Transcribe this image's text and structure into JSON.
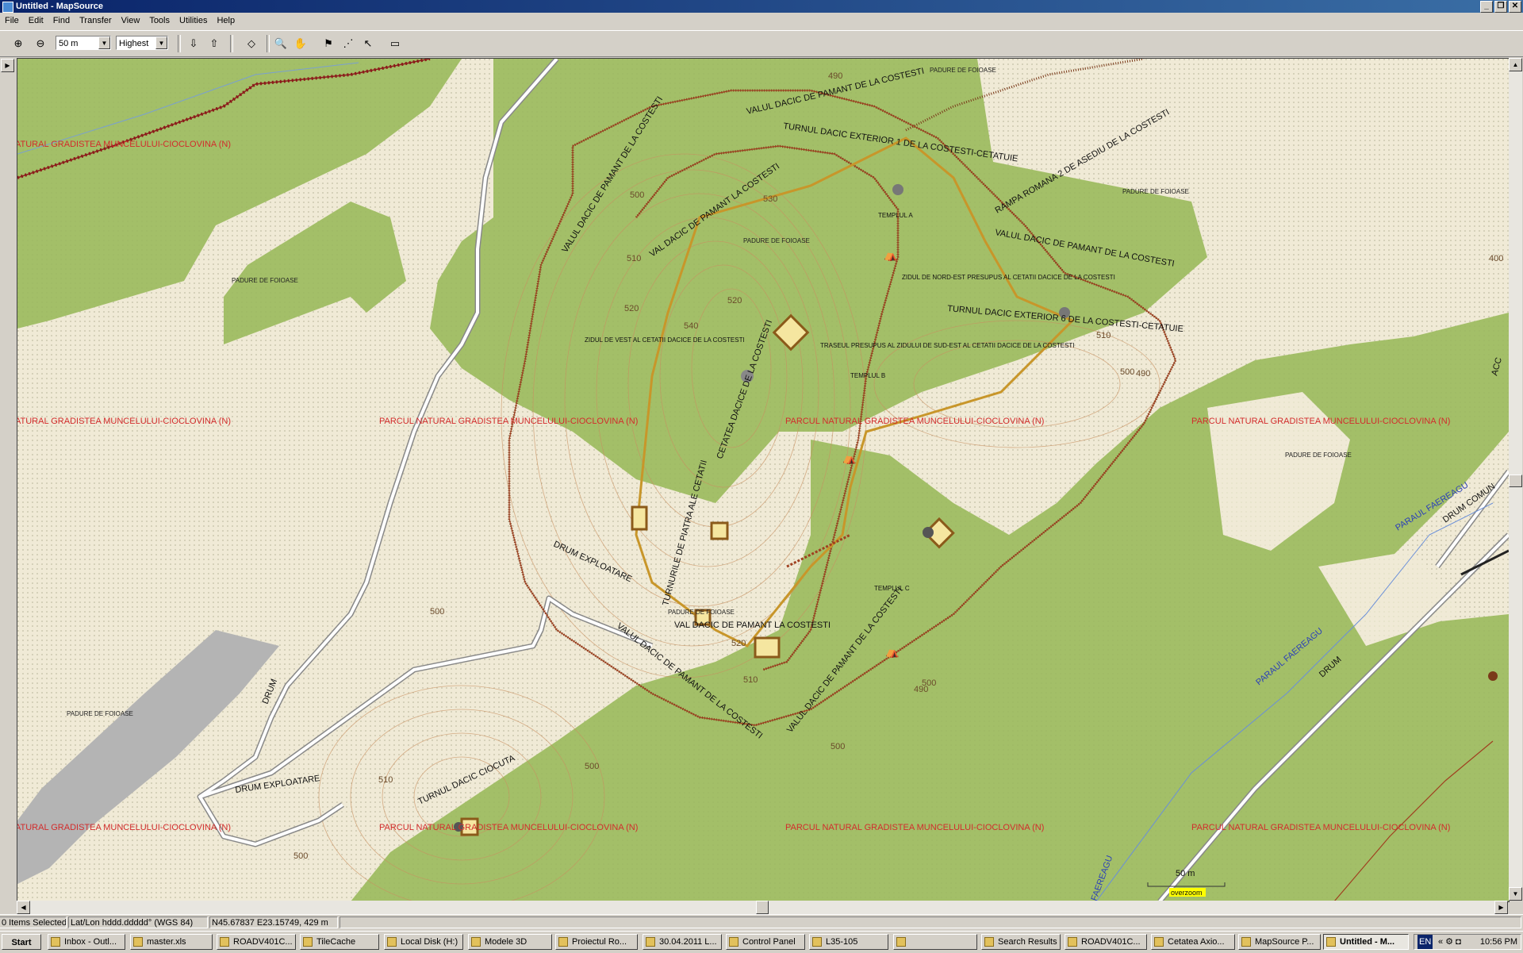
{
  "window": {
    "title": "Untitled - MapSource"
  },
  "menu": [
    "File",
    "Edit",
    "Find",
    "Transfer",
    "View",
    "Tools",
    "Utilities",
    "Help"
  ],
  "toolbar": {
    "zoom_value": "50 m",
    "detail_value": "Highest"
  },
  "map": {
    "park_label": "PARCUL NATURAL GRADISTEA MUNCELULUI-CIOCLOVINA (N)",
    "park_label_cut": "ATURAL GRADISTEA MUNCELULUI-CIOCLOVINA (N)",
    "forest_label": "PADURE DE FOIOASE",
    "labels": {
      "valul_top": "VALUL DACIC DE PAMANT DE LA COSTESTI",
      "turnul1": "TURNUL DACIC EXTERIOR 1 DE LA COSTESTI-CETATUIE",
      "rampa": "RAMPA ROMANA 2 DE ASEDIU DE LA COSTESTI",
      "valul_left": "VALUL DACIC DE PAMANT DE LA COSTESTI",
      "val_inner": "VAL DACIC DE PAMANT LA COSTESTI",
      "templul_a": "TEMPLUL A",
      "templul_b": "TEMPLUL B",
      "templul_c": "TEMPLUL C",
      "zid_nord": "ZIDUL DE NORD-EST PRESUPUS AL CETATII DACICE DE LA COSTESTI",
      "turnul6": "TURNUL DACIC EXTERIOR 6 DE LA COSTESTI-CETATUIE",
      "valul_right": "VALUL DACIC DE PAMANT DE LA COSTESTI",
      "zid_vest": "ZIDUL DE VEST AL CETATII DACICE DE LA COSTESTI",
      "traseul": "TRASEUL PRESUPUS AL ZIDULUI DE SUD-EST AL CETATII DACICE DE LA COSTESTI",
      "cetatea": "CETATEA DACICE DE LA COSTESTI",
      "piatra": "TURNURILE DE PIATRA ALE CETATII",
      "drum_exp1": "DRUM EXPLOATARE",
      "drum_exp2": "DRUM EXPLOATARE",
      "drum": "DRUM",
      "val_bottom": "VAL DACIC DE PAMANT LA COSTESTI",
      "valul_b1": "VALUL DACIC DE PAMANT DE LA COSTESTI",
      "valul_b2": "VALUL DACIC DE PAMANT DE LA COSTESTI",
      "turnul_ciocuta": "TURNUL DACIC CIOCUTA",
      "paraul1": "PARAUL FAEREAGU",
      "paraul2": "PARAUL FAEREAGU",
      "paraul3": "FAEREAGU",
      "drum_right": "DRUM",
      "drum_comun": "DRUM COMUN",
      "acc": "ACC"
    },
    "contours": [
      "490",
      "500",
      "510",
      "520",
      "530",
      "540",
      "520",
      "510",
      "500",
      "490",
      "400",
      "500",
      "510",
      "520",
      "500",
      "510",
      "490",
      "500",
      "500",
      "500"
    ],
    "scale_label": "50 m",
    "overzoom": "overzoom"
  },
  "status": {
    "selected": "0 Items Selected",
    "format": "Lat/Lon hddd.ddddd° (WGS 84)",
    "position": "N45.67837 E23.15749, 429 m"
  },
  "taskbar": {
    "start": "Start",
    "items": [
      "Inbox - Outl...",
      "master.xls",
      "ROADV401C...",
      "TileCache",
      "Local Disk (H:)",
      "Modele 3D",
      "Proiectul Ro...",
      "30.04.2011 L...",
      "Control Panel",
      "L35-105",
      "",
      "Search Results",
      "ROADV401C...",
      "Cetatea Axio...",
      "MapSource P...",
      "Untitled - M..."
    ],
    "lang": "EN",
    "time": "10:56 PM"
  },
  "colors": {
    "forest": "#a3bf68",
    "open": "#f0ead6",
    "road": "#9a9a9a",
    "rail": "#8b1a1a",
    "wall": "#c8962a",
    "park": "#d22c2c"
  }
}
